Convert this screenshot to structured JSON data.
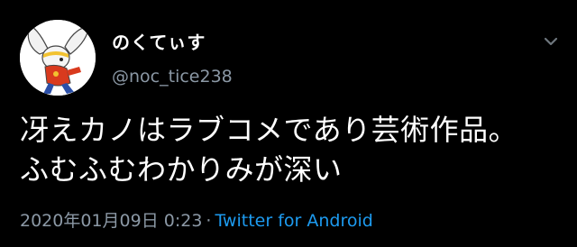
{
  "tweet": {
    "display_name": "のくてぃす",
    "handle": "@noc_tice238",
    "text": "冴えカノはラブコメであり芸術作品。ふむふむわかりみが深い",
    "timestamp": "2020年01月09日 0:23",
    "separator": "·",
    "source": "Twitter for Android",
    "menu_icon": "chevron-down-icon",
    "avatar_icon": "avatar"
  },
  "colors": {
    "background": "#000000",
    "text": "#ffffff",
    "secondary": "#8b98a5",
    "link": "#1d9bf0"
  }
}
